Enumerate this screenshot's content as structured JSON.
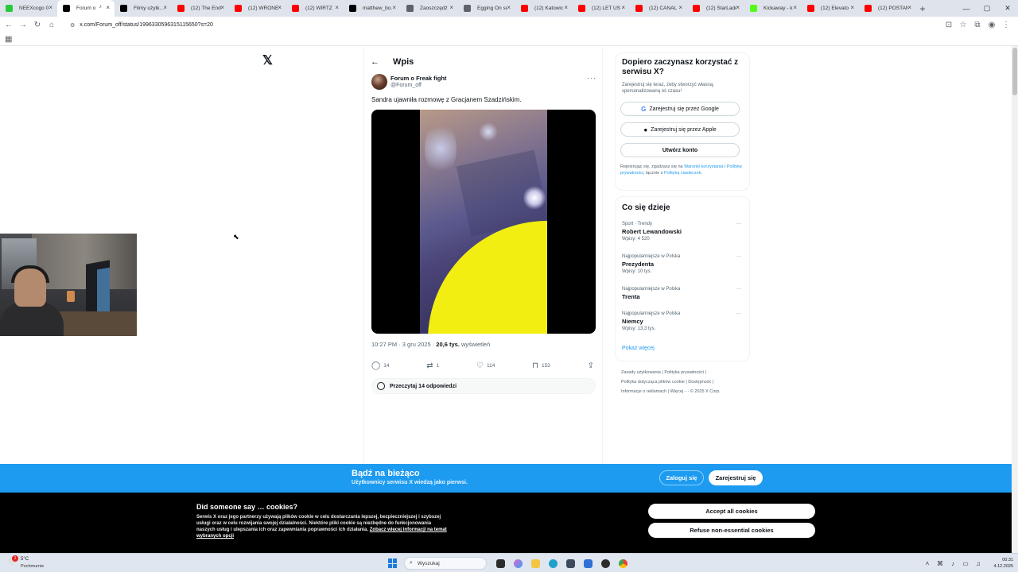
{
  "browser": {
    "tabs": [
      {
        "label": "NEEXcogo 0…",
        "color": "#27c93f",
        "active": false
      },
      {
        "label": "Forum o",
        "color": "#000000",
        "active": true
      },
      {
        "label": "Filmy użytk…",
        "color": "#000000",
        "active": false
      },
      {
        "label": "(12) The End",
        "color": "#ff0000",
        "active": false
      },
      {
        "label": "(12) WRONE",
        "color": "#ff0000",
        "active": false
      },
      {
        "label": "(12) WIRTZ",
        "color": "#ff0000",
        "active": false
      },
      {
        "label": "matthew_bo…",
        "color": "#000000",
        "active": false
      },
      {
        "label": "Zaoszczędź",
        "color": "#5f6368",
        "active": false
      },
      {
        "label": "Egging On su",
        "color": "#5f6368",
        "active": false
      },
      {
        "label": "(12) Katowic",
        "color": "#ff0000",
        "active": false
      },
      {
        "label": "(12) LET US",
        "color": "#ff0000",
        "active": false
      },
      {
        "label": "(12) CANAL",
        "color": "#ff0000",
        "active": false
      },
      {
        "label": "(12) StarLadd",
        "color": "#ff0000",
        "active": false
      },
      {
        "label": "Kickaway - k",
        "color": "#53fc18",
        "active": false
      },
      {
        "label": "(12) Elevato",
        "color": "#ff0000",
        "active": false
      },
      {
        "label": "(12) POSTAN",
        "color": "#ff0000",
        "active": false
      }
    ],
    "url": "x.com/Forum_off/status/1996330596315115650?s=20"
  },
  "post": {
    "header_title": "Wpis",
    "author_name": "Forum o Freak fight",
    "author_handle": "@Forum_off",
    "text": "Sandra ujawniła rozmowę z Gracjanem Szadzińskim.",
    "time": "10:27 PM · 3 gru 2025 · ",
    "views_count": "20,6 tys.",
    "views_label": " wyświetleń",
    "replies": "14",
    "reposts": "1",
    "likes": "114",
    "bookmarks": "153",
    "read_replies": "Przeczytaj 14 odpowiedzi"
  },
  "signup": {
    "title": "Dopiero zaczynasz korzystać z serwisu X?",
    "subtitle": "Zarejestruj się teraz, żeby stworzyć własną, spersonalizowaną oś czasu!",
    "google": "Zarejestruj się przez Google",
    "apple": "Zarejestruj się przez Apple",
    "create": "Utwórz konto",
    "legal_prefix": "Rejestrując się, zgadzasz się na ",
    "legal_terms": "Warunki korzystania",
    "legal_sep1": " i ",
    "legal_privacy": "Politykę prywatności",
    "legal_mid": ", łącznie z ",
    "legal_cookies": "Polityką ciasteczek",
    "legal_end": "."
  },
  "trends": {
    "title": "Co się dzieje",
    "items": [
      {
        "category": "Sport · Trendy",
        "name": "Robert Lewandowski",
        "count": "Wpisy: 4 520"
      },
      {
        "category": "Najpopularniejsze w Polska",
        "name": "Prezydenta",
        "count": "Wpisy: 10 tys."
      },
      {
        "category": "Najpopularniejsze w Polska",
        "name": "Trenta",
        "count": ""
      },
      {
        "category": "Najpopularniejsze w Polska",
        "name": "Niemcy",
        "count": "Wpisy: 13,3 tys."
      }
    ],
    "show_more": "Pokaż więcej"
  },
  "footer": {
    "line1": "Zasady użytkowania  |  Polityka prywatności  |",
    "line2": "Polityka dotycząca plików cookie  |  Dostępność  |",
    "line3": "Informacje o reklamach  |  Więcej ···  © 2025 X Corp."
  },
  "login_banner": {
    "title": "Bądź na bieżąco",
    "subtitle": "Użytkownicy serwisu X wiedzą jako pierwsi.",
    "login": "Zaloguj się",
    "signup": "Zarejestruj się"
  },
  "cookie": {
    "title": "Did someone say … cookies?",
    "text": "Serwis X oraz jego partnerzy używają plików cookie w celu dostarczania lepszej, bezpieczniejszej i szybszej usługi oraz w celu rozwijania swojej działalności. Niektóre pliki cookie są niezbędne do funkcjonowania naszych usług i ulepszania ich oraz zapewniania poprawności ich działania.",
    "link": "Zobacz więcej informacji na temat wybranych opcji",
    "accept": "Accept all cookies",
    "refuse": "Refuse non-essential cookies"
  },
  "taskbar": {
    "weather_temp": "5°C",
    "weather_desc": "Pochmurnie",
    "weather_badge": "1",
    "search_placeholder": "Wyszukaj",
    "time": "00:31",
    "date": "4.12.2025"
  }
}
